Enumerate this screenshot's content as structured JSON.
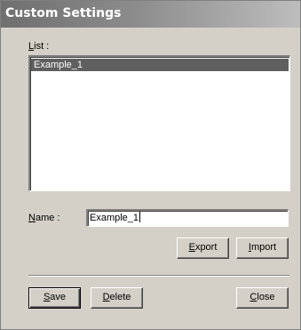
{
  "window": {
    "title": "Custom Settings"
  },
  "list": {
    "label_mnemonic": "L",
    "label_rest": "ist :",
    "items": [
      "Example_1"
    ],
    "selected_index": 0
  },
  "name": {
    "label_mnemonic": "N",
    "label_rest": "ame :",
    "value": "Example_1"
  },
  "buttons": {
    "export": {
      "mnemonic": "E",
      "rest": "xport"
    },
    "import": {
      "mnemonic": "I",
      "rest": "mport"
    },
    "save": {
      "mnemonic": "S",
      "rest": "ave"
    },
    "delete": {
      "mnemonic": "D",
      "rest": "elete"
    },
    "close": {
      "mnemonic": "C",
      "rest": "lose"
    }
  },
  "colors": {
    "titlebar_start": "#6f6f6f",
    "titlebar_end": "#bdbdbd",
    "face": "#d4d0c8",
    "selection": "#5f5f5f"
  }
}
